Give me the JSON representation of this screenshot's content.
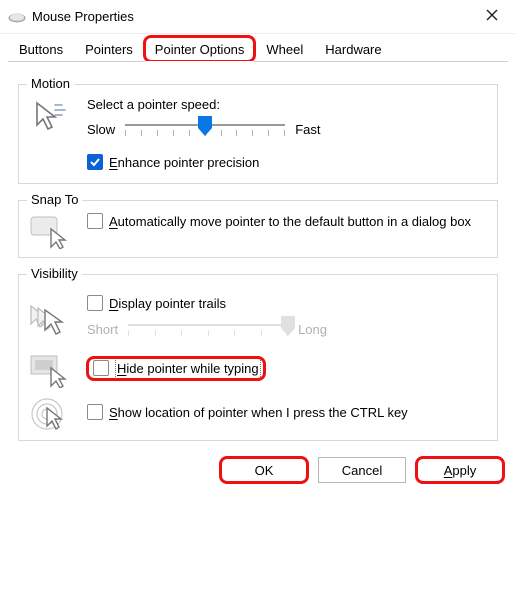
{
  "window": {
    "title": "Mouse Properties",
    "close_label": "Close"
  },
  "tabs": {
    "buttons": "Buttons",
    "pointers": "Pointers",
    "pointer_options": "Pointer Options",
    "wheel": "Wheel",
    "hardware": "Hardware",
    "active": "pointer_options"
  },
  "motion": {
    "group_title": "Motion",
    "heading": "Select a pointer speed:",
    "slow": "Slow",
    "fast": "Fast",
    "speed_value": 6,
    "speed_min": 1,
    "speed_max": 11,
    "enhance_prefix": "E",
    "enhance_rest": "nhance pointer precision",
    "enhance_checked": true
  },
  "snap": {
    "group_title": "Snap To",
    "label_prefix": "A",
    "label_rest": "utomatically move pointer to the default button in a dialog box",
    "checked": false
  },
  "visibility": {
    "group_title": "Visibility",
    "trails_prefix": "D",
    "trails_rest": "isplay pointer trails",
    "trails_checked": false,
    "trails_short": "Short",
    "trails_long": "Long",
    "hide_prefix": "H",
    "hide_rest": "ide pointer while typing",
    "hide_checked": false,
    "ctrl_prefix": "S",
    "ctrl_rest": "how location of pointer when I press the CTRL key",
    "ctrl_checked": false
  },
  "buttons": {
    "ok": "OK",
    "cancel": "Cancel",
    "apply_prefix": "A",
    "apply_rest": "pply"
  },
  "highlights": {
    "tab_pointer_options": true,
    "hide_pointer_row": true,
    "ok_button": true,
    "apply_button": true
  }
}
